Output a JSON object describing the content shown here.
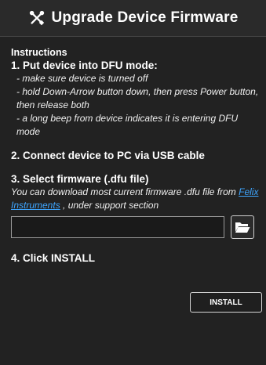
{
  "title": {
    "icon": "tools-icon",
    "text": "Upgrade Device Firmware"
  },
  "instructions_label": "Instructions",
  "step1": {
    "title": "1. Put device into DFU mode:",
    "lines": [
      "- make sure device is turned off",
      "- hold Down-Arrow button down, then press Power button, then release both",
      "- a long beep from device indicates it is entering DFU mode"
    ]
  },
  "step2": {
    "title": "2. Connect device to PC via USB cable"
  },
  "step3": {
    "title": "3. Select firmware (.dfu file)",
    "desc_before": "You can download most current firmware .dfu file from ",
    "link_text": "Felix Instruments",
    "desc_after": " , under support section",
    "file_value": "",
    "browse_icon": "folder-open-icon"
  },
  "step4": {
    "title": "4. Click INSTALL",
    "install_label": "INSTALL"
  }
}
